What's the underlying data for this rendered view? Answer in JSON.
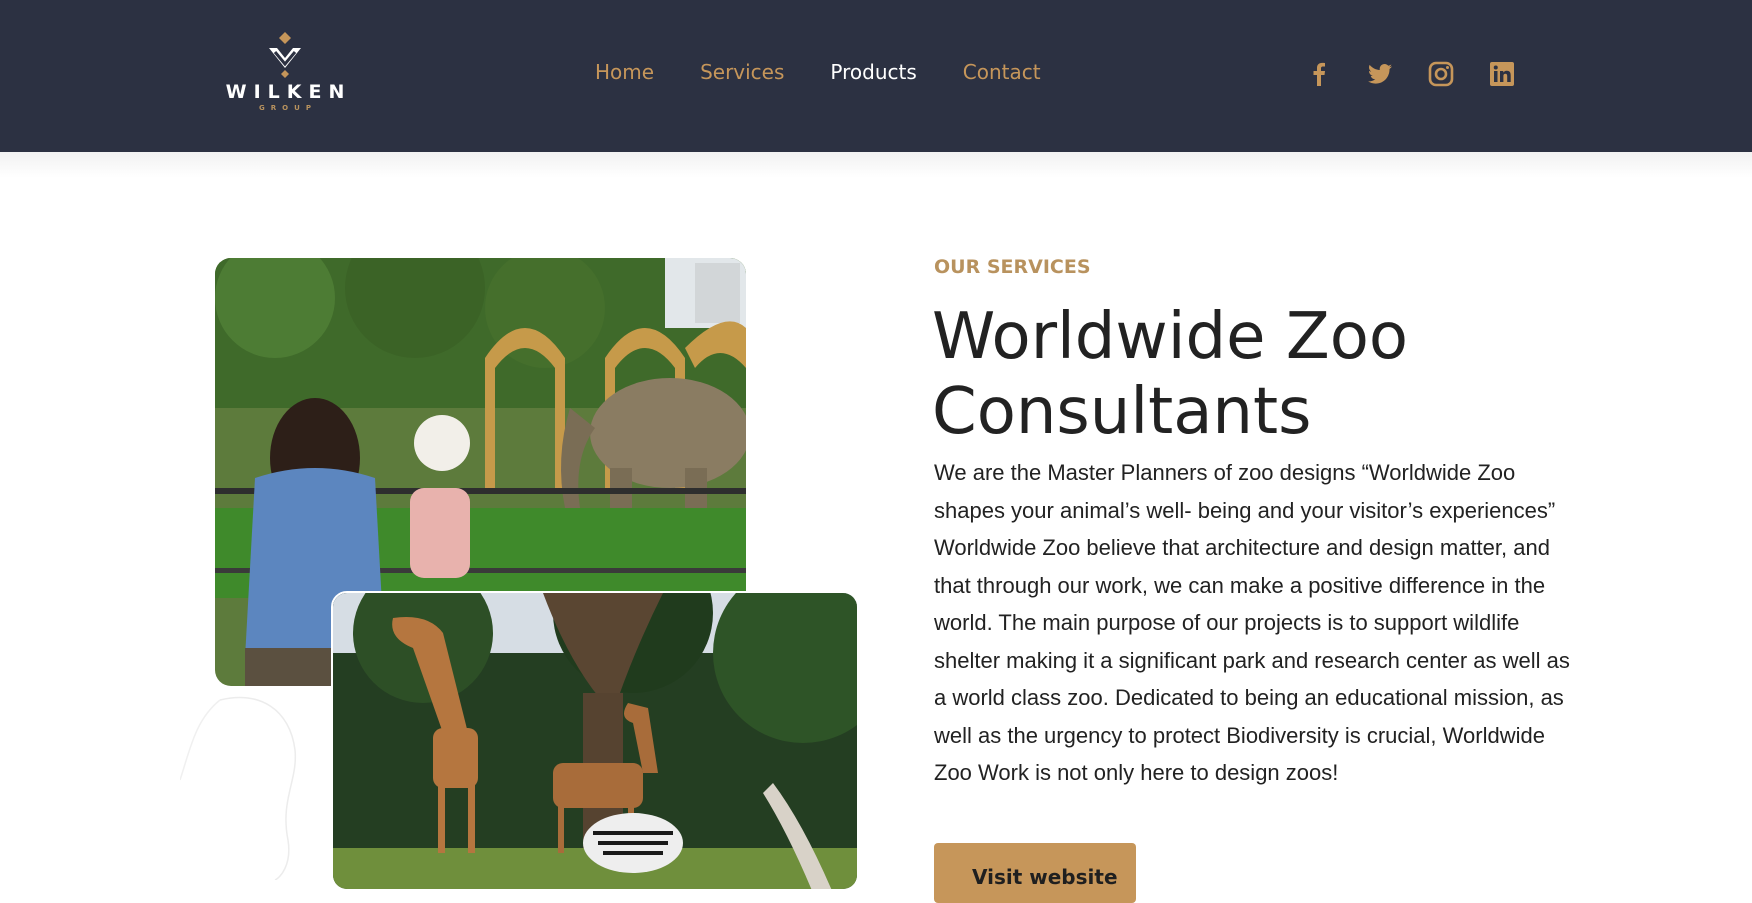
{
  "header": {
    "logo": {
      "word": "WILKEN",
      "sub": "GROUP"
    },
    "nav": [
      {
        "label": "Home"
      },
      {
        "label": "Services"
      },
      {
        "label": "Products",
        "active": true
      },
      {
        "label": "Contact"
      }
    ],
    "social_icons": [
      "facebook-icon",
      "twitter-icon",
      "instagram-icon",
      "linkedin-icon"
    ]
  },
  "main": {
    "images": [
      {
        "name": "zoo-elephant-visitors-image",
        "alt": "Woman and child watching elephant at zoo"
      },
      {
        "name": "zoo-giraffes-zebras-image",
        "alt": "Giraffes and zebras grazing"
      }
    ],
    "eyebrow": "OUR SERVICES",
    "title_line1": "Worldwide Zoo",
    "title_line2": "Consultants",
    "body": "We are the Master Planners of zoo designs “Worldwide Zoo shapes your animal’s well- being and your visitor’s experiences” Worldwide Zoo believe that architecture and design matter, and that through our work, we can make a positive difference in the world. The main purpose of our projects is to support wildlife shelter making it a significant park and research center as well as a world class zoo. Dedicated to being an educational mission, as well as the urgency to protect Biodiversity is crucial, Worldwide Zoo Work is not only here to design zoos!",
    "cta": "Visit website"
  },
  "colors": {
    "header_bg": "#2c3142",
    "accent": "#c6965a",
    "text": "#222222"
  }
}
